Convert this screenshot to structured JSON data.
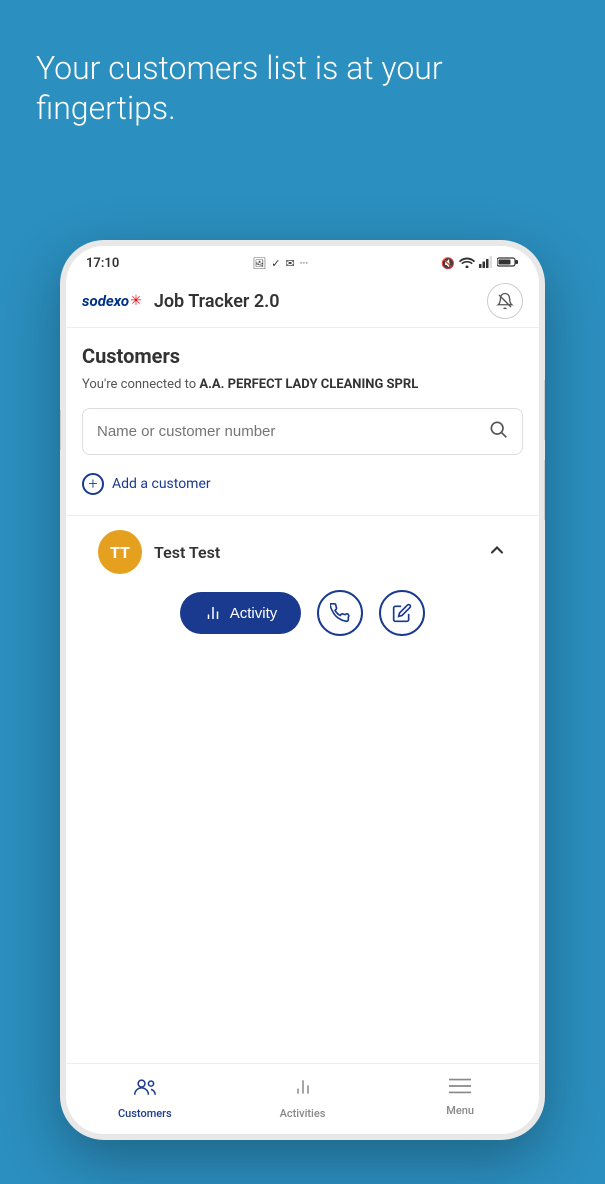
{
  "hero": {
    "text": "Your customers list is at your fingertips."
  },
  "status_bar": {
    "time": "17:10",
    "icons_left": "🖼 ✔ 📧 ···",
    "icons_right": "🔇 WiFi Signal Battery"
  },
  "app_bar": {
    "logo_text": "sodexo",
    "logo_star": "✳",
    "title": "Job Tracker 2.0",
    "notification_icon": "🔔"
  },
  "customers_section": {
    "title": "Customers",
    "connected_text_prefix": "You're connected to ",
    "connected_company": "A.A. PERFECT LADY CLEANING SPRL",
    "search_placeholder": "Name or customer number",
    "add_customer_label": "Add a customer"
  },
  "customer_list": [
    {
      "initials": "TT",
      "name": "Test Test",
      "expanded": true,
      "actions": [
        {
          "id": "activity",
          "label": "Activity",
          "primary": true
        },
        {
          "id": "call",
          "label": "Call",
          "primary": false
        },
        {
          "id": "edit",
          "label": "Edit",
          "primary": false
        }
      ]
    }
  ],
  "bottom_nav": {
    "items": [
      {
        "id": "customers",
        "label": "Customers",
        "icon": "👥",
        "active": true
      },
      {
        "id": "activities",
        "label": "Activities",
        "icon": "📊",
        "active": false
      },
      {
        "id": "menu",
        "label": "Menu",
        "icon": "☰",
        "active": false
      }
    ]
  }
}
